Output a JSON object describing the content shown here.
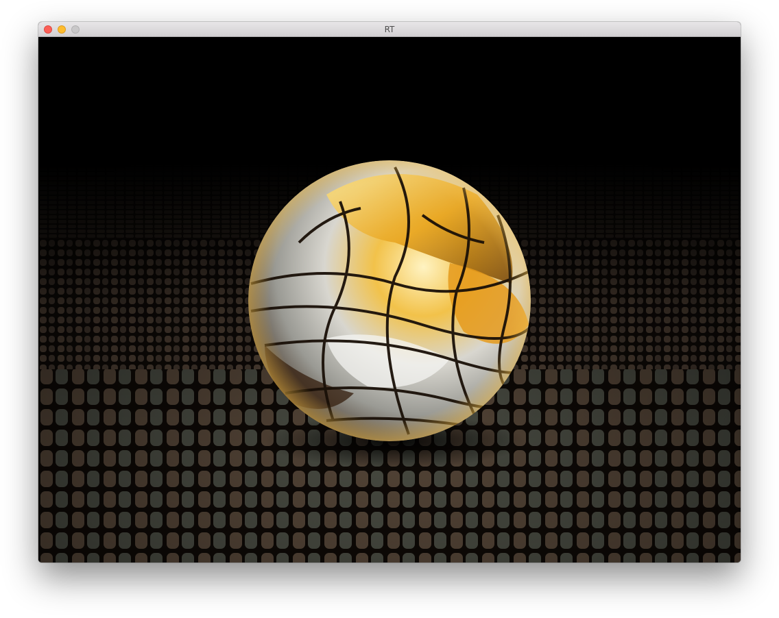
{
  "window": {
    "title": "RT",
    "controls": [
      "close",
      "minimize",
      "zoom"
    ],
    "control_colors": {
      "close": "#fc5f57",
      "minimize": "#fdbc2e",
      "zoom": "#c9c8c9"
    }
  },
  "scene": {
    "description_icon": "render-canvas",
    "background": "#000000",
    "floor_color": "#5a4a3c",
    "sphere_colors": {
      "gold": "#f2b42a",
      "silver": "#e8ecef",
      "dark": "#2a1a10"
    }
  }
}
